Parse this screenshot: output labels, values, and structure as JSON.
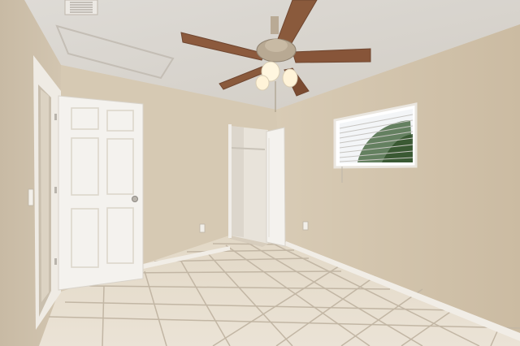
{
  "scene": {
    "subject": "empty bedroom",
    "colors": {
      "ceiling": "#d9d5cf",
      "wall_left": "#cfc2ad",
      "wall_back": "#d6c9b3",
      "wall_right": "#d3c5ae",
      "floor_tile": "#e5dccd",
      "grout": "#bfb3a1",
      "door": "#f4f2ee",
      "baseboard": "#f0ece5",
      "fan_blade": "#8a5a3c",
      "fan_metal": "#b9aa95"
    }
  },
  "watermark": {
    "text": ""
  }
}
